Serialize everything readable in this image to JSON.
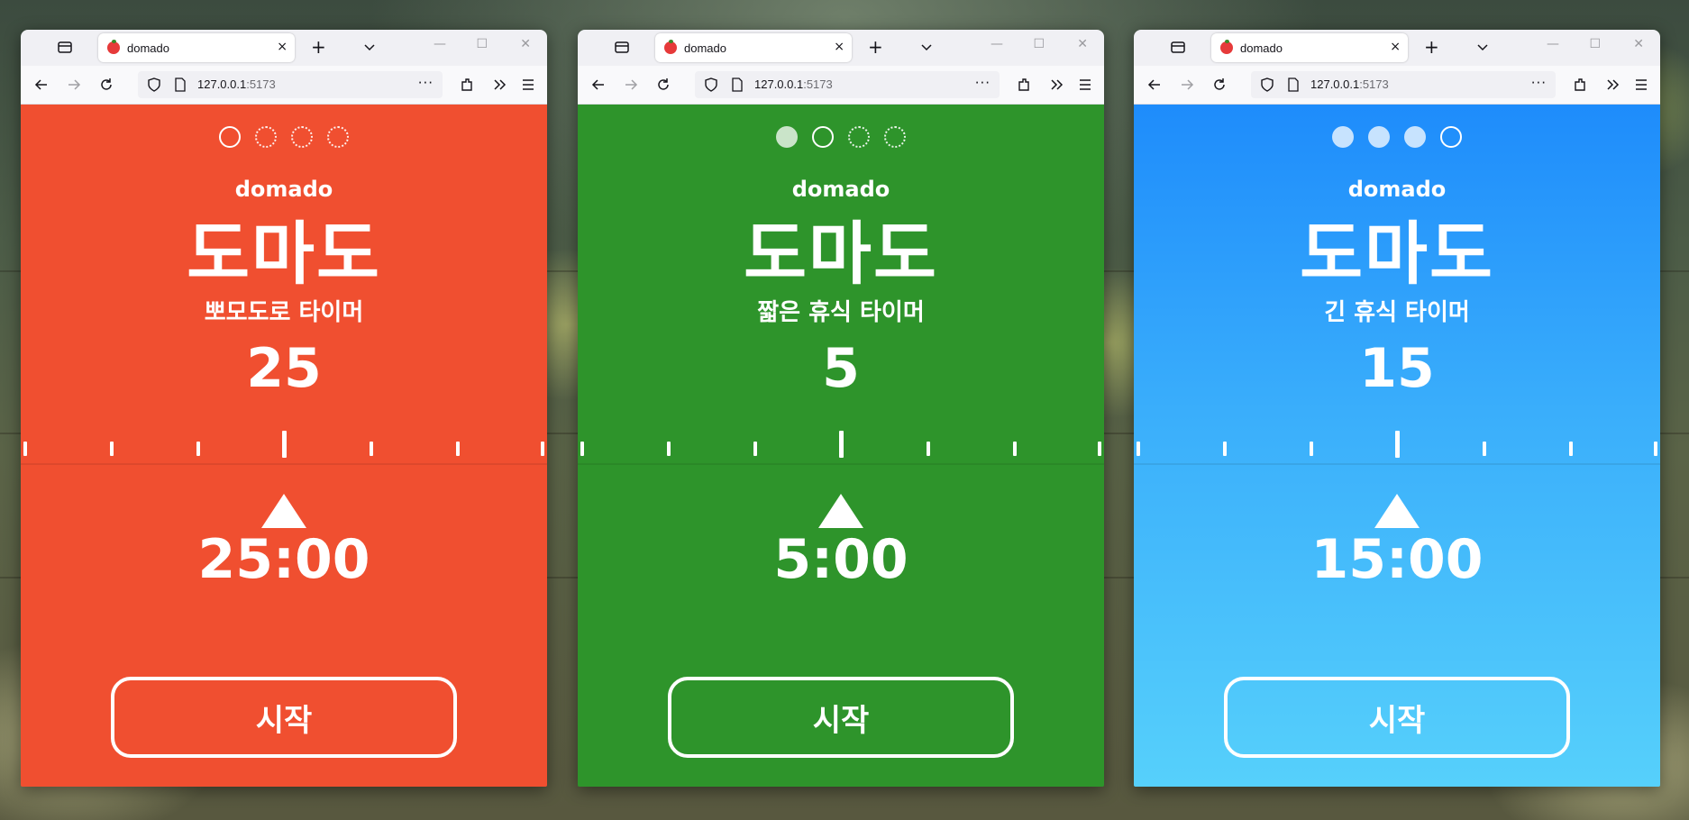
{
  "windows": [
    {
      "theme": "red",
      "color": "#f04f30",
      "tab_title": "domado",
      "url_host": "127.0.0.1",
      "url_port": ":5173",
      "session_dots": [
        "current",
        "pending",
        "pending",
        "pending"
      ],
      "brand": "domado",
      "title": "도마도",
      "subtitle": "뽀모도로 타이머",
      "minutes": "25",
      "time": "25:00",
      "start_label": "시작"
    },
    {
      "theme": "green",
      "color": "#2e942b",
      "tab_title": "domado",
      "url_host": "127.0.0.1",
      "url_port": ":5173",
      "session_dots": [
        "done",
        "current",
        "pending",
        "pending"
      ],
      "brand": "domado",
      "title": "도마도",
      "subtitle": "짧은 휴식 타이머",
      "minutes": "5",
      "time": "5:00",
      "start_label": "시작"
    },
    {
      "theme": "blue",
      "color": "#1e8cfb",
      "tab_title": "domado",
      "url_host": "127.0.0.1",
      "url_port": ":5173",
      "session_dots": [
        "done",
        "done",
        "done",
        "current"
      ],
      "brand": "domado",
      "title": "도마도",
      "subtitle": "긴 휴식 타이머",
      "minutes": "15",
      "time": "15:00",
      "start_label": "시작"
    }
  ],
  "icons": {
    "tab_list": "tab-list-icon",
    "new_tab": "+",
    "tab_close": "×",
    "minimize": "—",
    "maximize": "☐",
    "close": "✕",
    "back": "back-arrow-icon",
    "forward": "forward-arrow-icon",
    "reload": "reload-icon",
    "more": "···"
  }
}
